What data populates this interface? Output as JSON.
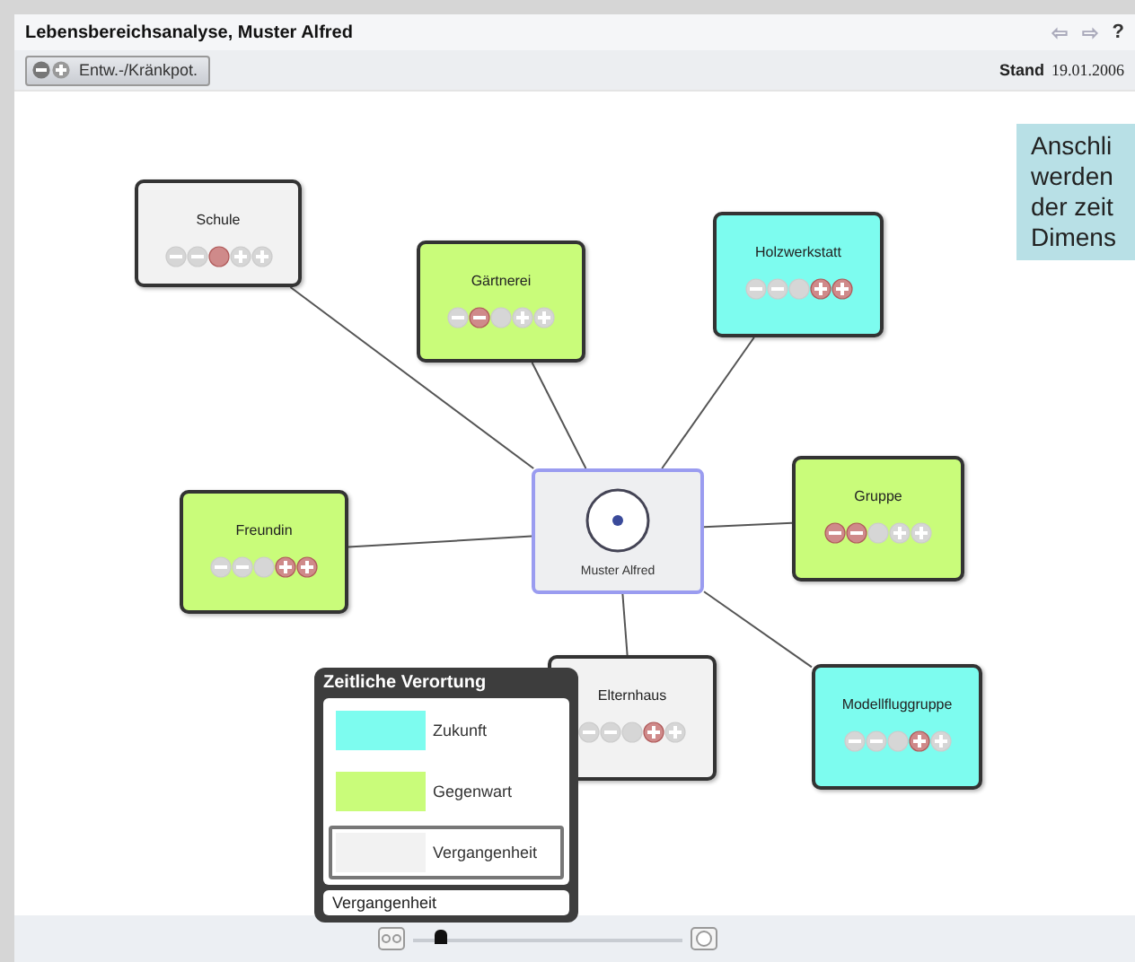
{
  "window": {
    "title": "Lebensbereichsanalyse, Muster Alfred",
    "nav": [
      "⇦",
      "⇨",
      "?"
    ]
  },
  "toolbar": {
    "button": "Entw.-/Kränkpot.",
    "stand_label": "Stand",
    "stand_date": "19.01.2006"
  },
  "center": {
    "name": "Muster Alfred"
  },
  "nodes": [
    {
      "name": "Schule",
      "color": "#f2f2f2",
      "rating": [
        false,
        false,
        true,
        false,
        false
      ]
    },
    {
      "name": "Gärtnerei",
      "color": "#c9fc7a",
      "rating": [
        false,
        true,
        false,
        false,
        false
      ]
    },
    {
      "name": "Holzwerkstatt",
      "color": "#7dfcef",
      "rating": [
        false,
        false,
        false,
        true,
        true
      ]
    },
    {
      "name": "Freundin",
      "color": "#c9fc7a",
      "rating": [
        false,
        false,
        false,
        true,
        true
      ]
    },
    {
      "name": "Gruppe",
      "color": "#c9fc7a",
      "rating": [
        true,
        true,
        false,
        false,
        false
      ]
    },
    {
      "name": "Elternhaus",
      "color": "#f2f2f2",
      "rating": [
        false,
        false,
        false,
        true,
        false
      ]
    },
    {
      "name": "Modellfluggruppe",
      "color": "#7dfcef",
      "rating": [
        false,
        false,
        false,
        true,
        false
      ]
    }
  ],
  "legend": {
    "title": "Zeitliche Verortung",
    "items": [
      {
        "label": "Zukunft",
        "color": "#7dfcef",
        "selected": false
      },
      {
        "label": "Gegenwart",
        "color": "#c9fc7a",
        "selected": false
      },
      {
        "label": "Vergangenheit",
        "color": "#f2f2f2",
        "selected": true
      }
    ],
    "value": "Vergangenheit"
  },
  "callout": {
    "lines": [
      "Anschli",
      "werden",
      "der zeit",
      "Dimens"
    ]
  },
  "zoom": {
    "level": 0.1
  }
}
